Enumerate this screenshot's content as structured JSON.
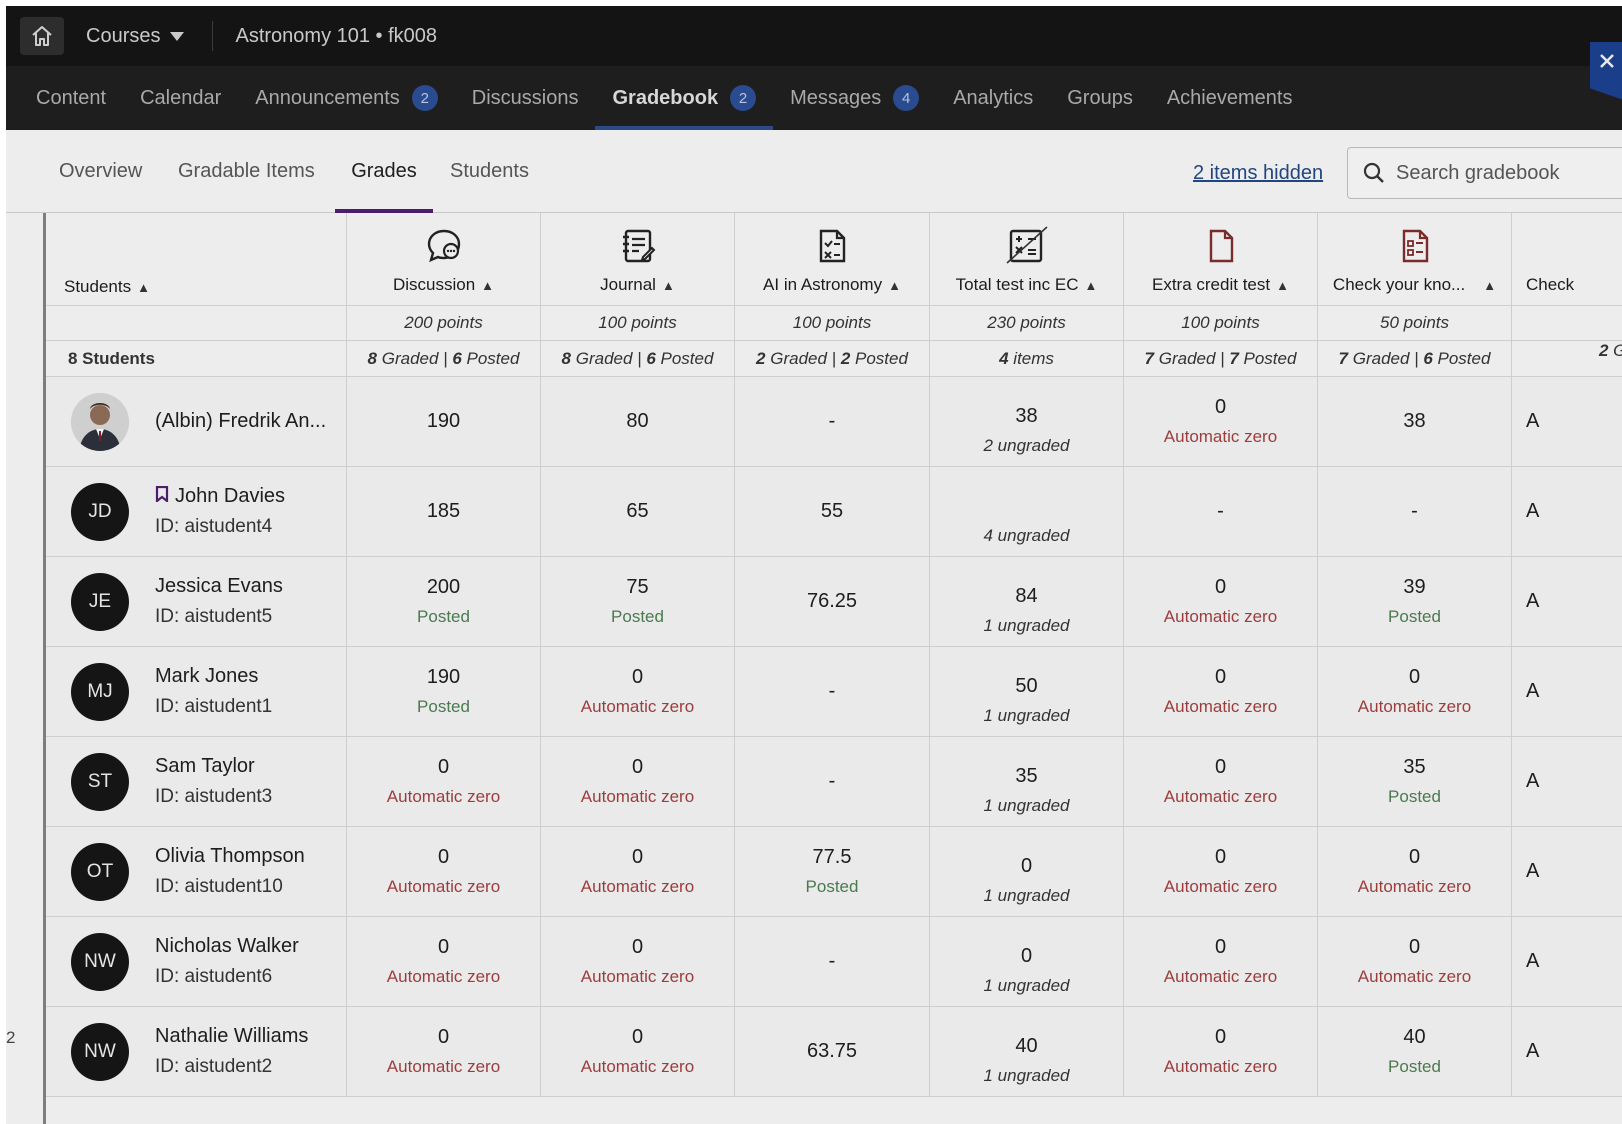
{
  "topbar": {
    "courses_label": "Courses",
    "course_title": "Astronomy 101 • fk008"
  },
  "main_tabs": [
    {
      "label": "Content",
      "badge": null
    },
    {
      "label": "Calendar",
      "badge": null
    },
    {
      "label": "Announcements",
      "badge": "2"
    },
    {
      "label": "Discussions",
      "badge": null
    },
    {
      "label": "Gradebook",
      "badge": "2",
      "active": true
    },
    {
      "label": "Messages",
      "badge": "4"
    },
    {
      "label": "Analytics",
      "badge": null
    },
    {
      "label": "Groups",
      "badge": null
    },
    {
      "label": "Achievements",
      "badge": null
    }
  ],
  "sub_tabs": [
    {
      "label": "Overview"
    },
    {
      "label": "Gradable Items"
    },
    {
      "label": "Grades",
      "active": true
    },
    {
      "label": "Students"
    }
  ],
  "hidden_items_link": "2 items hidden",
  "search": {
    "placeholder": "Search gradebook"
  },
  "left_edge_number": "2",
  "columns": {
    "students_header": "Students",
    "student_count": "8 Students",
    "items": [
      {
        "icon": "discussion-icon",
        "title": "Discussion",
        "points": "200 points",
        "summary_a": "8",
        "summary_a_label": " Graded | ",
        "summary_b": "6",
        "summary_b_label": " Posted"
      },
      {
        "icon": "journal-icon",
        "title": "Journal",
        "points": "100 points",
        "summary_a": "8",
        "summary_a_label": " Graded | ",
        "summary_b": "6",
        "summary_b_label": " Posted"
      },
      {
        "icon": "assignment-icon",
        "title": "AI in Astronomy",
        "points": "100 points",
        "summary_a": "2",
        "summary_a_label": " Graded | ",
        "summary_b": "2",
        "summary_b_label": " Posted"
      },
      {
        "icon": "total-calculation-icon",
        "title": "Total test inc EC",
        "points": "230 points",
        "summary_a": "4",
        "summary_a_label": " items",
        "summary_b": "",
        "summary_b_label": ""
      },
      {
        "icon": "document-icon",
        "title": "Extra credit test",
        "points": "100 points",
        "summary_a": "7",
        "summary_a_label": " Graded | ",
        "summary_b": "7",
        "summary_b_label": " Posted"
      },
      {
        "icon": "test-icon",
        "title": "Check your kno...",
        "points": "50 points",
        "summary_a": "7",
        "summary_a_label": " Graded | ",
        "summary_b": "6",
        "summary_b_label": " Posted"
      },
      {
        "icon": "",
        "title": "Check",
        "points": "",
        "summary_a": "2",
        "summary_a_label": " Gr",
        "summary_b": "",
        "summary_b_label": ""
      }
    ]
  },
  "students": [
    {
      "name": "(Albin) Fredrik An...",
      "id": "",
      "initials": "",
      "photo": true,
      "flag": false,
      "grades": [
        {
          "v": "190",
          "s": ""
        },
        {
          "v": "80",
          "s": ""
        },
        {
          "v": "-",
          "s": ""
        },
        {
          "v": "38",
          "s": "2 ungraded",
          "t": "ung"
        },
        {
          "v": "0",
          "s": "Automatic zero",
          "t": "zero"
        },
        {
          "v": "38",
          "s": ""
        },
        {
          "v": "A",
          "s": ""
        }
      ]
    },
    {
      "name": "John Davies",
      "id": "ID: aistudent4",
      "initials": "JD",
      "photo": false,
      "flag": true,
      "grades": [
        {
          "v": "185",
          "s": ""
        },
        {
          "v": "65",
          "s": ""
        },
        {
          "v": "55",
          "s": ""
        },
        {
          "v": "",
          "s": "4 ungraded",
          "t": "ung"
        },
        {
          "v": "-",
          "s": ""
        },
        {
          "v": "-",
          "s": ""
        },
        {
          "v": "A",
          "s": ""
        }
      ]
    },
    {
      "name": "Jessica Evans",
      "id": "ID: aistudent5",
      "initials": "JE",
      "photo": false,
      "flag": false,
      "grades": [
        {
          "v": "200",
          "s": "Posted",
          "t": "posted"
        },
        {
          "v": "75",
          "s": "Posted",
          "t": "posted"
        },
        {
          "v": "76.25",
          "s": ""
        },
        {
          "v": "84",
          "s": "1 ungraded",
          "t": "ung"
        },
        {
          "v": "0",
          "s": "Automatic zero",
          "t": "zero"
        },
        {
          "v": "39",
          "s": "Posted",
          "t": "posted"
        },
        {
          "v": "A",
          "s": ""
        }
      ]
    },
    {
      "name": "Mark Jones",
      "id": "ID: aistudent1",
      "initials": "MJ",
      "photo": false,
      "flag": false,
      "grades": [
        {
          "v": "190",
          "s": "Posted",
          "t": "posted"
        },
        {
          "v": "0",
          "s": "Automatic zero",
          "t": "zero"
        },
        {
          "v": "-",
          "s": ""
        },
        {
          "v": "50",
          "s": "1 ungraded",
          "t": "ung"
        },
        {
          "v": "0",
          "s": "Automatic zero",
          "t": "zero"
        },
        {
          "v": "0",
          "s": "Automatic zero",
          "t": "zero"
        },
        {
          "v": "A",
          "s": ""
        }
      ]
    },
    {
      "name": "Sam Taylor",
      "id": "ID: aistudent3",
      "initials": "ST",
      "photo": false,
      "flag": false,
      "grades": [
        {
          "v": "0",
          "s": "Automatic zero",
          "t": "zero"
        },
        {
          "v": "0",
          "s": "Automatic zero",
          "t": "zero"
        },
        {
          "v": "-",
          "s": ""
        },
        {
          "v": "35",
          "s": "1 ungraded",
          "t": "ung"
        },
        {
          "v": "0",
          "s": "Automatic zero",
          "t": "zero"
        },
        {
          "v": "35",
          "s": "Posted",
          "t": "posted"
        },
        {
          "v": "A",
          "s": ""
        }
      ]
    },
    {
      "name": "Olivia Thompson",
      "id": "ID: aistudent10",
      "initials": "OT",
      "photo": false,
      "flag": false,
      "grades": [
        {
          "v": "0",
          "s": "Automatic zero",
          "t": "zero"
        },
        {
          "v": "0",
          "s": "Automatic zero",
          "t": "zero"
        },
        {
          "v": "77.5",
          "s": "Posted",
          "t": "posted"
        },
        {
          "v": "0",
          "s": "1 ungraded",
          "t": "ung"
        },
        {
          "v": "0",
          "s": "Automatic zero",
          "t": "zero"
        },
        {
          "v": "0",
          "s": "Automatic zero",
          "t": "zero"
        },
        {
          "v": "A",
          "s": ""
        }
      ]
    },
    {
      "name": "Nicholas Walker",
      "id": "ID: aistudent6",
      "initials": "NW",
      "photo": false,
      "flag": false,
      "grades": [
        {
          "v": "0",
          "s": "Automatic zero",
          "t": "zero"
        },
        {
          "v": "0",
          "s": "Automatic zero",
          "t": "zero"
        },
        {
          "v": "-",
          "s": ""
        },
        {
          "v": "0",
          "s": "1 ungraded",
          "t": "ung"
        },
        {
          "v": "0",
          "s": "Automatic zero",
          "t": "zero"
        },
        {
          "v": "0",
          "s": "Automatic zero",
          "t": "zero"
        },
        {
          "v": "A",
          "s": ""
        }
      ]
    },
    {
      "name": "Nathalie Williams",
      "id": "ID: aistudent2",
      "initials": "NW",
      "photo": false,
      "flag": false,
      "grades": [
        {
          "v": "0",
          "s": "Automatic zero",
          "t": "zero"
        },
        {
          "v": "0",
          "s": "Automatic zero",
          "t": "zero"
        },
        {
          "v": "63.75",
          "s": ""
        },
        {
          "v": "40",
          "s": "1 ungraded",
          "t": "ung"
        },
        {
          "v": "0",
          "s": "Automatic zero",
          "t": "zero"
        },
        {
          "v": "40",
          "s": "Posted",
          "t": "posted"
        },
        {
          "v": "A",
          "s": ""
        }
      ]
    }
  ],
  "colors": {
    "posted": "#4b7a4f",
    "automatic_zero": "#9c3d3d",
    "nav_badge": "#2a4b8f",
    "active_subtab": "#4c1d6b",
    "close_panel": "#1b3e8a"
  }
}
